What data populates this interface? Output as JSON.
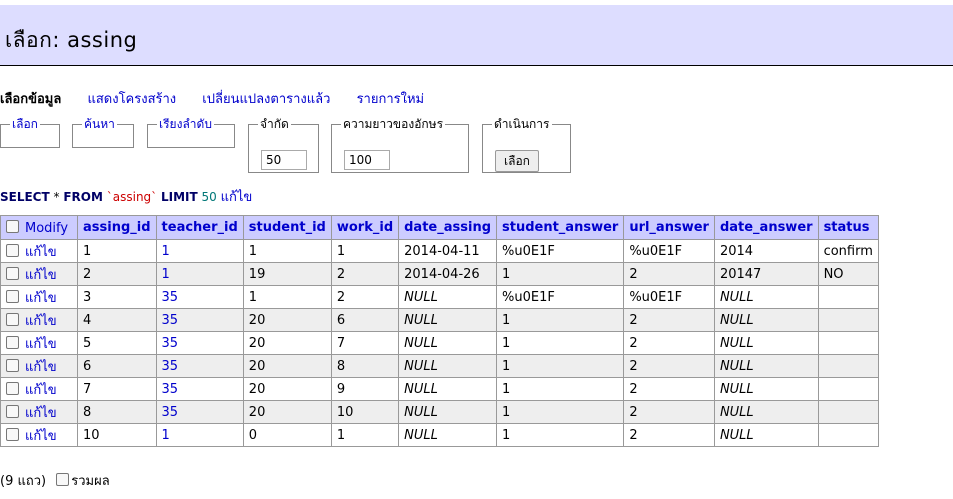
{
  "title": "เลือก: assing",
  "menu": {
    "browse": "เลือกข้อมูล",
    "structure": "แสดงโครงสร้าง",
    "alter": "เปลี่ยนแปลงตารางแล้ว",
    "new_item": "รายการใหม่"
  },
  "controls": {
    "select_legend": "เลือก",
    "search_legend": "ค้นหา",
    "sort_legend": "เรียงลำดับ",
    "limit_legend": "จำกัด",
    "limit_value": "50",
    "textlength_legend": "ความยาวของอักษร",
    "textlength_value": "100",
    "action_legend": "ดำเนินการ",
    "action_button": "เลือก"
  },
  "sql": {
    "select": "SELECT",
    "star": " * ",
    "from": "FROM",
    "table": "`assing`",
    "limit": "LIMIT",
    "limit_num": "50",
    "edit": "แก้ไข"
  },
  "table": {
    "modify_header": "Modify",
    "columns": [
      "assing_id",
      "teacher_id",
      "student_id",
      "work_id",
      "date_assing",
      "student_answer",
      "url_answer",
      "date_answer",
      "status"
    ],
    "edit_label": "แก้ไข",
    "rows": [
      [
        "1",
        "1",
        "1",
        "1",
        "2014-04-11",
        "%u0E1F",
        "%u0E1F",
        "2014",
        "confirm"
      ],
      [
        "2",
        "1",
        "19",
        "2",
        "2014-04-26",
        "1",
        "2",
        "20147",
        "NO"
      ],
      [
        "3",
        "35",
        "1",
        "2",
        "NULL",
        "%u0E1F",
        "%u0E1F",
        "NULL",
        ""
      ],
      [
        "4",
        "35",
        "20",
        "6",
        "NULL",
        "1",
        "2",
        "NULL",
        ""
      ],
      [
        "5",
        "35",
        "20",
        "7",
        "NULL",
        "1",
        "2",
        "NULL",
        ""
      ],
      [
        "6",
        "35",
        "20",
        "8",
        "NULL",
        "1",
        "2",
        "NULL",
        ""
      ],
      [
        "7",
        "35",
        "20",
        "9",
        "NULL",
        "1",
        "2",
        "NULL",
        ""
      ],
      [
        "8",
        "35",
        "20",
        "10",
        "NULL",
        "1",
        "2",
        "NULL",
        ""
      ],
      [
        "10",
        "1",
        "0",
        "1",
        "NULL",
        "1",
        "2",
        "NULL",
        ""
      ]
    ]
  },
  "footer": {
    "count": "(9 แถว)",
    "aggregate": "รวมผล"
  }
}
